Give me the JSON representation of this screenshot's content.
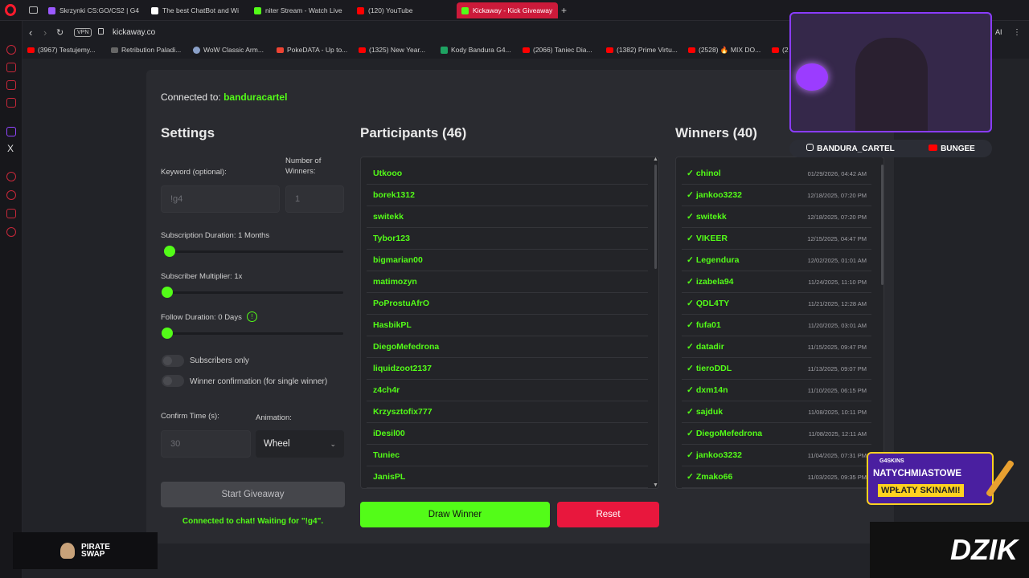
{
  "browser": {
    "tabs": [
      {
        "label": "Skrzynki CS:GO/CS2 | G4",
        "color": "#9b59ff"
      },
      {
        "label": "The best ChatBot and Wi",
        "color": "#ffffff"
      },
      {
        "label": "niter Stream - Watch Live",
        "color": "#53fc18"
      },
      {
        "label": "(120) YouTube",
        "color": "#ff0000"
      },
      {
        "label": "Kickaway - Kick Giveaway",
        "color": "#53fc18"
      }
    ],
    "new_tab": "+",
    "vpn": "VPN",
    "url": "kickaway.co",
    "ai_label": "AI",
    "bookmarks": [
      "(3967) Testujemy...",
      "Retribution Paladi...",
      "WoW Classic Arm...",
      "PokeDATA - Up to...",
      "(1325) New Year...",
      "Kody Bandura G4...",
      "(2066) Taniec Dia...",
      "(1382) Prime Virtu...",
      "(2528) 🔥 MIX DO...",
      "(2"
    ]
  },
  "page": {
    "connected_prefix": "Connected to:",
    "channel": "banduracartel",
    "settings_title": "Settings",
    "keyword_label": "Keyword (optional):",
    "keyword_placeholder": "!g4",
    "winners_label": "Number of Winners:",
    "winners_placeholder": "1",
    "sub_duration_label": "Subscription Duration: 1 Months",
    "sub_duration_value": 0,
    "sub_multiplier_label": "Subscriber Multiplier: 1x",
    "sub_multiplier_value": 0,
    "follow_duration_label": "Follow Duration: 0 Days",
    "follow_duration_value": 0,
    "info_icon_glyph": "!",
    "subscribers_only": "Subscribers only",
    "winner_confirmation": "Winner confirmation (for single winner)",
    "confirm_time_label": "Confirm Time (s):",
    "confirm_time_placeholder": "30",
    "animation_label": "Animation:",
    "animation_value": "Wheel",
    "start_button": "Start Giveaway",
    "status": "Connected to chat! Waiting for \"!g4\".",
    "participants_title": "Participants (46)",
    "participants": [
      "Utkooo",
      "borek1312",
      "switekk",
      "Tybor123",
      "bigmarian00",
      "matimozyn",
      "PoProstuAfrO",
      "HasbikPL",
      "DiegoMefedrona",
      "liquidzoot2137",
      "z4ch4r",
      "Krzysztofix777",
      "iDesil00",
      "Tuniec",
      "JanisPL"
    ],
    "draw_button": "Draw Winner",
    "reset_button": "Reset",
    "winners_title": "Winners (40)",
    "winners": [
      {
        "name": "chinol",
        "date": "01/29/2026, 04:42 AM"
      },
      {
        "name": "jankoo3232",
        "date": "12/18/2025, 07:20 PM"
      },
      {
        "name": "switekk",
        "date": "12/18/2025, 07:20 PM"
      },
      {
        "name": "VIKEER",
        "date": "12/15/2025, 04:47 PM"
      },
      {
        "name": "Legendura",
        "date": "12/02/2025, 01:01 AM"
      },
      {
        "name": "izabela94",
        "date": "11/24/2025, 11:10 PM"
      },
      {
        "name": "QDL4TY",
        "date": "11/21/2025, 12:28 AM"
      },
      {
        "name": "fufa01",
        "date": "11/20/2025, 03:01 AM"
      },
      {
        "name": "datadir",
        "date": "11/15/2025, 09:47 PM"
      },
      {
        "name": "tieroDDL",
        "date": "11/13/2025, 09:07 PM"
      },
      {
        "name": "dxm14n",
        "date": "11/10/2025, 06:15 PM"
      },
      {
        "name": "sajduk",
        "date": "11/08/2025, 10:11 PM"
      },
      {
        "name": "DiegoMefedrona",
        "date": "11/08/2025, 12:11 AM"
      },
      {
        "name": "jankoo3232",
        "date": "11/04/2025, 07:31 PM"
      },
      {
        "name": "Zmako66",
        "date": "11/03/2025, 09:35 PM"
      }
    ],
    "check": "✓"
  },
  "overlay": {
    "instagram": "BANDURA_CARTEL",
    "youtube": "BUNGEE",
    "promo_brand": "G4SKINS",
    "promo_line1": "NATYCHMIASTOWE",
    "promo_line2": "WPŁATY SKINAMI!",
    "dzik": "DZIK",
    "pirate_line1": "PIRATE",
    "pirate_line2": "SWAP"
  }
}
